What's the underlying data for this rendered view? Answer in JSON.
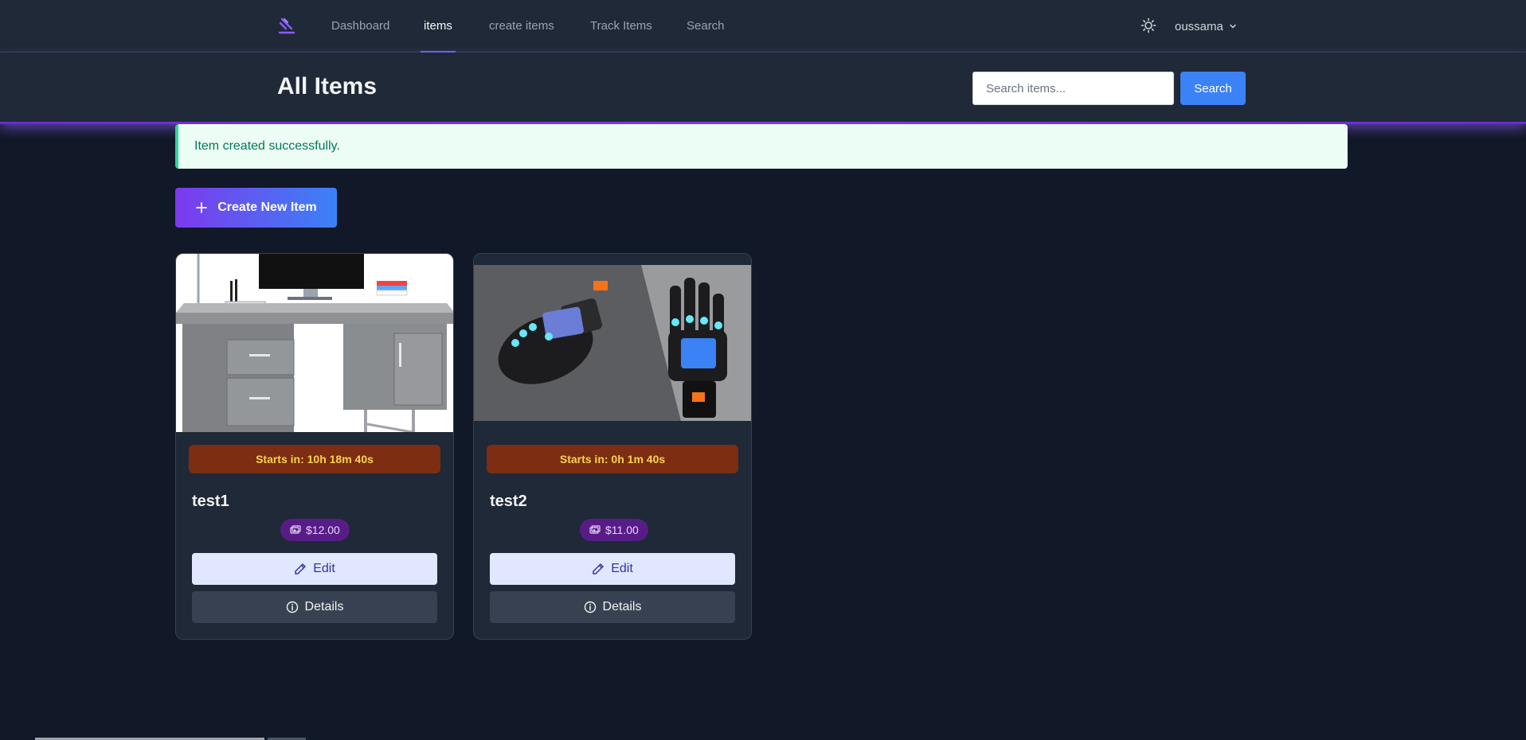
{
  "nav": {
    "links": [
      {
        "label": "Dashboard"
      },
      {
        "label": "items"
      },
      {
        "label": "create items"
      },
      {
        "label": "Track Items"
      },
      {
        "label": "Search"
      }
    ],
    "active": "items",
    "user": {
      "name": "oussama"
    }
  },
  "header": {
    "title": "All Items",
    "search_placeholder": "Search items...",
    "search_button": "Search"
  },
  "alert": {
    "message": "Item created successfully."
  },
  "create_button": "Create New Item",
  "items": [
    {
      "title": "test1",
      "countdown": "Starts in: 10h 18m 40s",
      "price": "$12.00",
      "edit_label": "Edit",
      "details_label": "Details",
      "image": "office-desk-photo"
    },
    {
      "title": "test2",
      "countdown": "Starts in: 0h 1m 40s",
      "price": "$11.00",
      "edit_label": "Edit",
      "details_label": "Details",
      "image": "smart-gloves-photo"
    }
  ],
  "colors": {
    "accent": "#6366f1",
    "brand_gradient_start": "#7c3aed",
    "brand_gradient_end": "#3b82f6",
    "success": "#047857",
    "countdown_bg": "#7c2d12",
    "price_badge_bg": "#581c87"
  }
}
